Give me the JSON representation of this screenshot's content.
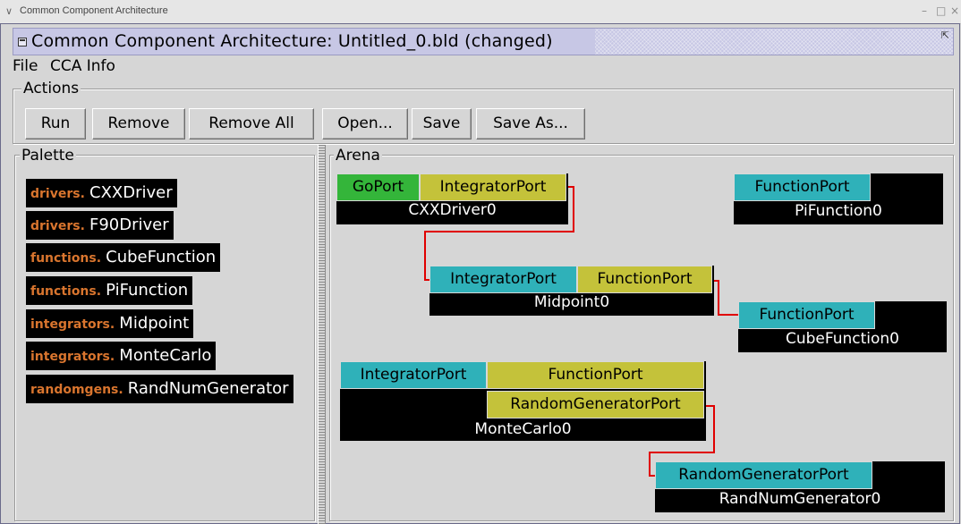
{
  "outer_window": {
    "title": "Common Component Architecture"
  },
  "window": {
    "title": "Common Component Architecture: Untitled_0.bld (changed)"
  },
  "menu": {
    "items": [
      "File",
      "CCA Info"
    ]
  },
  "actions": {
    "label": "Actions",
    "buttons": [
      "Run",
      "Remove",
      "Remove All",
      "Open...",
      "Save",
      "Save As..."
    ]
  },
  "palette": {
    "label": "Palette",
    "items": [
      {
        "prefix": "drivers.",
        "name": "CXXDriver"
      },
      {
        "prefix": "drivers.",
        "name": "F90Driver"
      },
      {
        "prefix": "functions.",
        "name": "CubeFunction"
      },
      {
        "prefix": "functions.",
        "name": "PiFunction"
      },
      {
        "prefix": "integrators.",
        "name": "Midpoint"
      },
      {
        "prefix": "integrators.",
        "name": "MonteCarlo"
      },
      {
        "prefix": "randomgens.",
        "name": "RandNumGenerator"
      }
    ]
  },
  "arena": {
    "label": "Arena",
    "components": {
      "cxxdriver": {
        "name": "CXXDriver0",
        "ports": [
          "GoPort",
          "IntegratorPort"
        ]
      },
      "pifunction": {
        "name": "PiFunction0",
        "ports": [
          "FunctionPort"
        ]
      },
      "midpoint": {
        "name": "Midpoint0",
        "ports": [
          "IntegratorPort",
          "FunctionPort"
        ]
      },
      "cubefunction": {
        "name": "CubeFunction0",
        "ports": [
          "FunctionPort"
        ]
      },
      "montecarlo": {
        "name": "MonteCarlo0",
        "ports": [
          "IntegratorPort",
          "FunctionPort",
          "RandomGeneratorPort"
        ]
      },
      "randnumgenerator": {
        "name": "RandNumGenerator0",
        "ports": [
          "RandomGeneratorPort"
        ]
      }
    }
  },
  "colors": {
    "uses_port": "#c4c23a",
    "provides_port": "#2fb1b9",
    "go_port": "#34b53a",
    "connection": "#e00000",
    "palette_prefix": "#d9752e"
  }
}
